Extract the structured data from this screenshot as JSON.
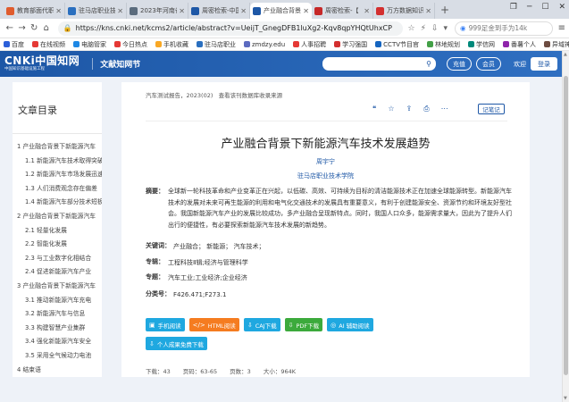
{
  "browser": {
    "tabs": [
      {
        "label": "教育部面代职",
        "color": "#e05c2e",
        "active": false
      },
      {
        "label": "驻马店职业技",
        "color": "#2a6fbf",
        "active": false
      },
      {
        "label": "2023年河南省",
        "color": "#5b6c7d",
        "active": false
      },
      {
        "label": "周密检索-中国",
        "color": "#1d57a6",
        "active": false
      },
      {
        "label": "产业融合背景下",
        "color": "#1d57a6",
        "active": true
      },
      {
        "label": "周密检索-【",
        "color": "#c62828",
        "active": false
      },
      {
        "label": "万方数据知识",
        "color": "#d32f2f",
        "active": false
      }
    ],
    "new_tab": "+",
    "url": "https://kns.cnki.net/kcms2/article/abstract?v=UeijT_GnegDFB1luXg2-Kqv8qpYHQtUhxCP",
    "search_placeholder": "999足金到手为14k",
    "bookmarks": [
      {
        "label": "百度",
        "color": "#2b5fd9"
      },
      {
        "label": "在线视频",
        "color": "#e53935"
      },
      {
        "label": "电脑管家",
        "color": "#1e88e5"
      },
      {
        "label": "今日热点",
        "color": "#e53935"
      },
      {
        "label": "手机收藏",
        "color": "#f9a825"
      },
      {
        "label": "驻马店职业",
        "color": "#2a6fbf"
      },
      {
        "label": "zmdzy.edu",
        "color": "#5c6bc0"
      },
      {
        "label": "人事招聘",
        "color": "#e53935"
      },
      {
        "label": "学习强国",
        "color": "#d32f2f"
      },
      {
        "label": "CCTV节目官",
        "color": "#1565c0"
      },
      {
        "label": "林地规划",
        "color": "#43a047"
      },
      {
        "label": "学信网",
        "color": "#00897b"
      },
      {
        "label": "番薯个人",
        "color": "#8e24aa"
      },
      {
        "label": "异域神探",
        "color": "#6d4c41"
      }
    ]
  },
  "header": {
    "logo_main": "CNKi中国知网",
    "logo_sub": "中国知识基础设施工程",
    "site_title": "文献知网节",
    "recharge": "充值",
    "member": "会员",
    "welcome": "欢迎",
    "login": "登录"
  },
  "toc": {
    "heading": "文章目录",
    "items": [
      {
        "label": "1 产业融合背景下新能源汽车",
        "sub": false
      },
      {
        "label": "1.1 新能源汽车技术取得突破",
        "sub": true
      },
      {
        "label": "1.2 新能源汽车市场发展迅速",
        "sub": true
      },
      {
        "label": "1.3 人们消费观念存在偏差",
        "sub": true
      },
      {
        "label": "1.4 新能源汽车部分技术短板",
        "sub": true
      },
      {
        "label": "2 产业融合背景下新能源汽车",
        "sub": false
      },
      {
        "label": "2.1 轻量化发展",
        "sub": true
      },
      {
        "label": "2.2 智能化发展",
        "sub": true
      },
      {
        "label": "2.3 与工业数字化相结合",
        "sub": true
      },
      {
        "label": "2.4 促进新能源汽车产业",
        "sub": true
      },
      {
        "label": "3 产业融合背景下新能源汽车",
        "sub": false
      },
      {
        "label": "3.1 推动新能源汽车充电",
        "sub": true
      },
      {
        "label": "3.2 新能源汽车与信息",
        "sub": true
      },
      {
        "label": "3.3 构建智慧产业集群",
        "sub": true
      },
      {
        "label": "3.4 强化新能源汽车安全",
        "sub": true
      },
      {
        "label": "3.5 采用全气候动力电池",
        "sub": true
      },
      {
        "label": "4 结束语",
        "sub": false
      }
    ]
  },
  "article": {
    "source": "汽车测试报告，2023(02)",
    "source_links": "查看该刊数据库收录来源",
    "note_button": "记笔记",
    "title": "产业融合背景下新能源汽车技术发展趋势",
    "author": "周宇宁",
    "org": "驻马店职业技术学院",
    "abstract_label": "摘要：",
    "abstract": "全球新一轮科技革命和产业变革正在兴起，以低碳、高效、可持续为目标的清洁能源技术正在加速全球能源转型。新能源汽车技术的发展对未来可再生能源的利用和电气化交通技术的发展具有重要意义，有利于创建能源安全、资源节约和环境友好型社会。我国新能源汽车产业的发展比较成功，多产业融合呈现新特点。同时，我国人口众多，能源需求量大，因此为了提升人们出行的便捷性，有必要探索新能源汽车技术发展的新趋势。",
    "keywords_label": "关键词：",
    "keywords": "产业融合；  新能源；  汽车技术；",
    "series_label": "专辑：",
    "series": "工程科技Ⅱ辑;经济与管理科学",
    "topic_label": "专题：",
    "topic": "汽车工业;工业经济;企业经济",
    "class_label": "分类号：",
    "class": "F426.471;F273.1",
    "downloads": [
      {
        "label": "手机阅读",
        "color": "#1fa8e0",
        "icon": "▣"
      },
      {
        "label": "HTML阅读",
        "color": "#f57c20",
        "icon": "</>"
      },
      {
        "label": "CAJ下载",
        "color": "#1fa8e0",
        "icon": "⇩"
      },
      {
        "label": "PDF下载",
        "color": "#3caa3c",
        "icon": "⇩"
      },
      {
        "label": "AI 辅助阅读",
        "color": "#1fa8e0",
        "icon": "◎"
      }
    ],
    "personal_download": "个人成果免费下载",
    "stats": {
      "downloads": "下载：43",
      "pages": "页码：63-65",
      "page_count": "页数：3",
      "size": "大小：964K"
    }
  }
}
